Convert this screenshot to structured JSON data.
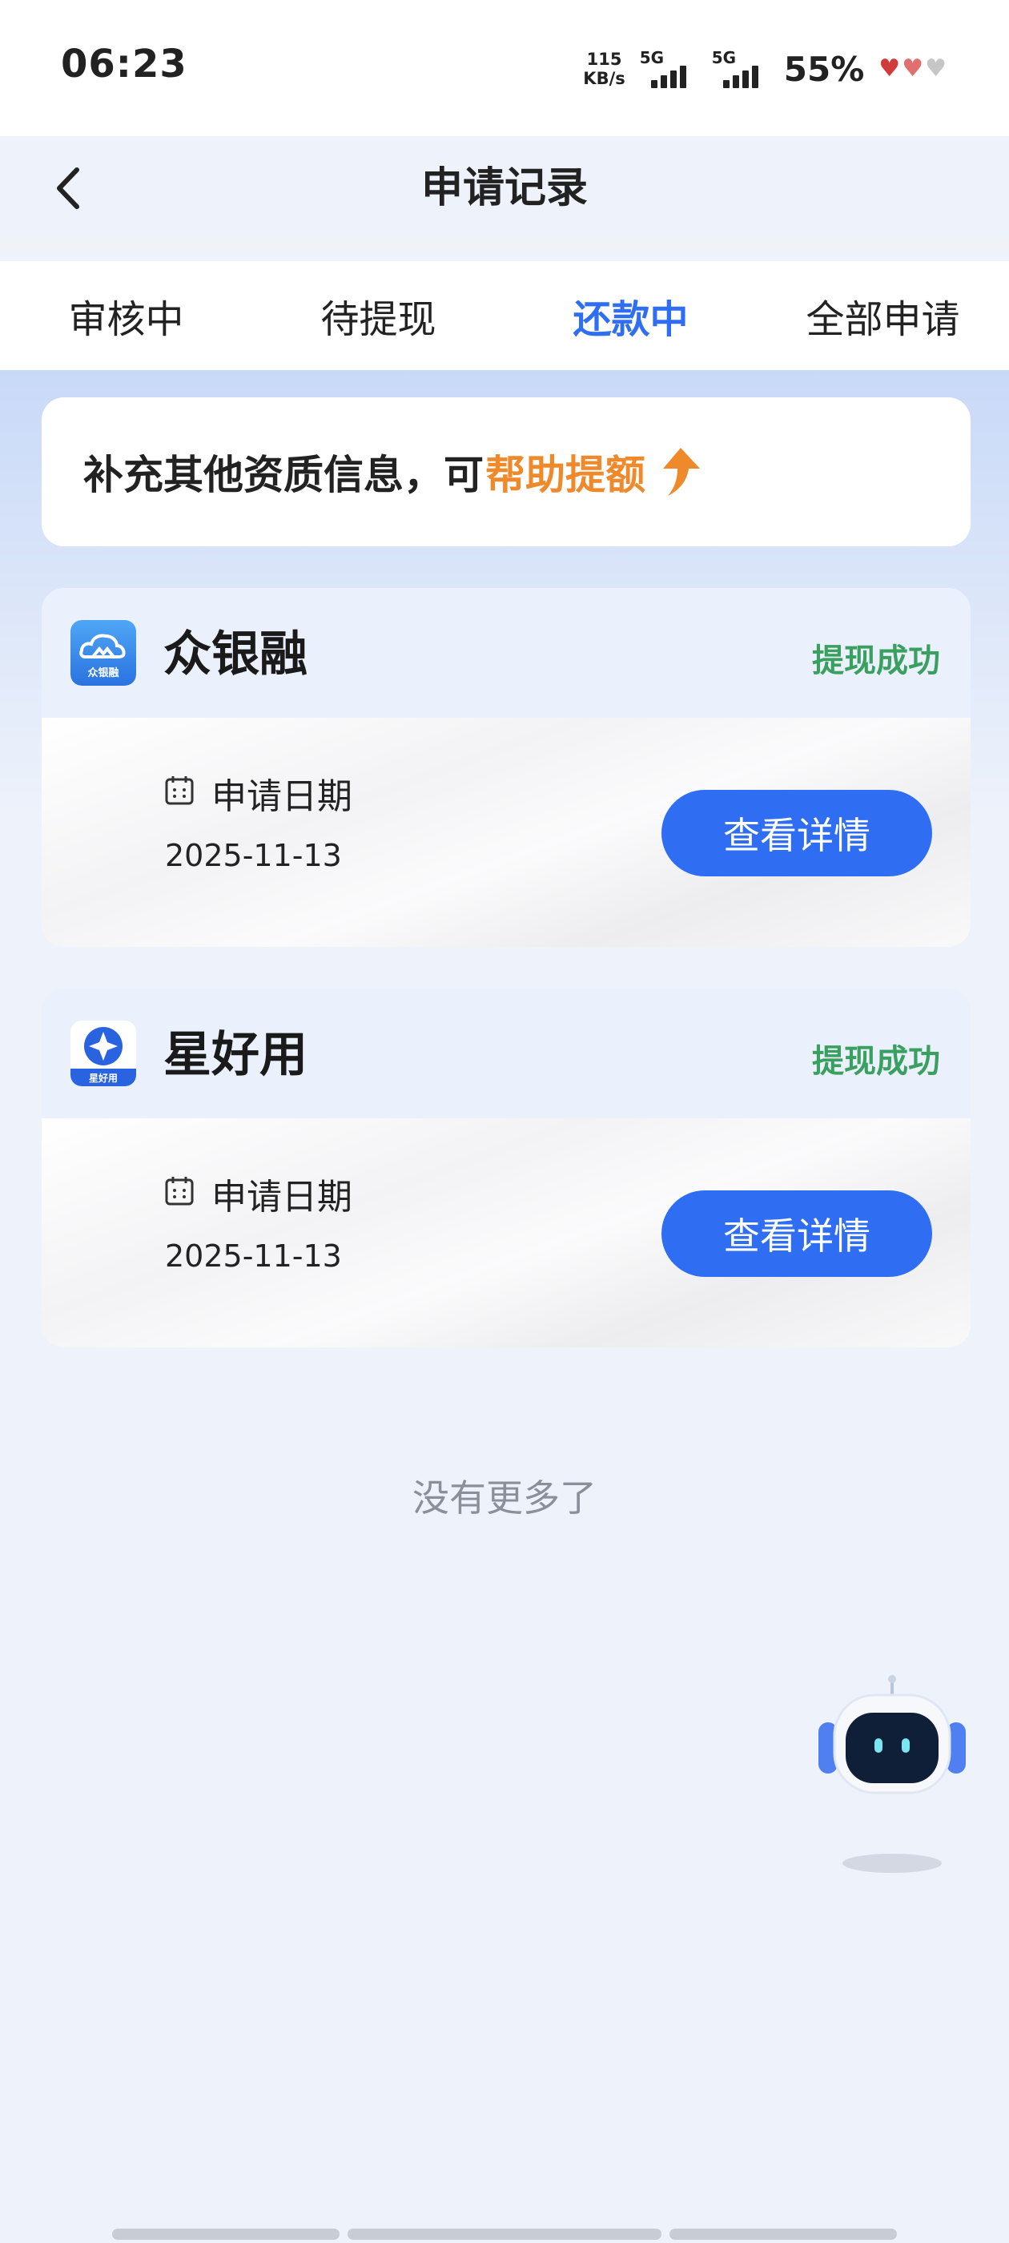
{
  "status_bar": {
    "time": "06:23",
    "net_speed_value": "115",
    "net_speed_unit": "KB/s",
    "signal1_label": "5G",
    "signal2_label": "5G",
    "battery": "55%"
  },
  "header": {
    "title": "申请记录",
    "back_icon": "chevron-left-icon"
  },
  "tabs": [
    {
      "label": "审核中",
      "active": false
    },
    {
      "label": "待提现",
      "active": false
    },
    {
      "label": "还款中",
      "active": true
    },
    {
      "label": "全部申请",
      "active": false
    }
  ],
  "banner": {
    "text": "补充其他资质信息，可",
    "highlight": "帮助提额",
    "icon": "arrow-up-icon",
    "highlight_color": "#ee8a2b"
  },
  "cards": [
    {
      "app_name": "众银融",
      "logo_text": "众银融",
      "status": "提现成功",
      "date_label": "申请日期",
      "date": "2025-11-13",
      "button": "查看详情"
    },
    {
      "app_name": "星好用",
      "logo_text": "星好用",
      "status": "提现成功",
      "date_label": "申请日期",
      "date": "2025-11-13",
      "button": "查看详情"
    }
  ],
  "footer_text": "没有更多了",
  "colors": {
    "accent": "#2f6ef2",
    "success": "#3aa05f",
    "highlight": "#ee8a2b"
  }
}
